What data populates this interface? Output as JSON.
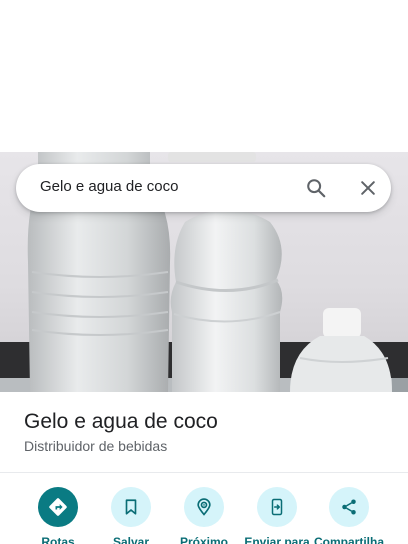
{
  "search": {
    "query": "Gelo e agua de coco",
    "search_icon": "search-icon",
    "close_icon": "close-icon"
  },
  "place": {
    "title": "Gelo e agua de coco",
    "category": "Distribuidor de bebidas"
  },
  "actions": [
    {
      "label": "Rotas",
      "icon": "directions-icon"
    },
    {
      "label": "Salvar",
      "icon": "bookmark-icon"
    },
    {
      "label": "Próximo",
      "icon": "nearby-icon"
    },
    {
      "label": "Enviar para",
      "icon": "send-to-phone-icon"
    },
    {
      "label": "Compartilha",
      "icon": "share-icon"
    }
  ],
  "colors": {
    "accent": "#0a7b83",
    "action_bg": "#d5f4fa",
    "action_label": "#0a6d75",
    "title": "#202124",
    "subtitle": "#5f6368"
  }
}
